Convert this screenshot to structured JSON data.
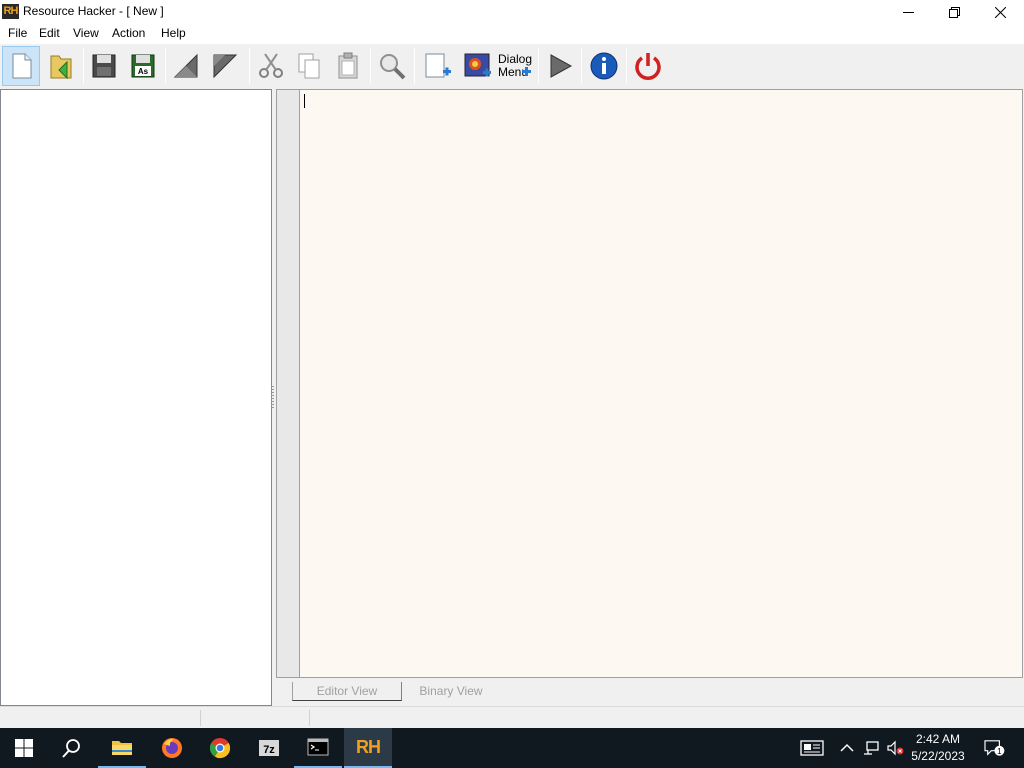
{
  "window": {
    "title": "Resource Hacker - [ New ]",
    "app_icon_text": "RH"
  },
  "menu": [
    {
      "label": "File"
    },
    {
      "label": "Edit"
    },
    {
      "label": "View"
    },
    {
      "label": "Action"
    },
    {
      "label": "Help"
    }
  ],
  "toolbar": {
    "dialog_menu_label_1": "Dialog",
    "dialog_menu_label_2": "Menu"
  },
  "tabs": {
    "editor_view": "Editor View",
    "binary_view": "Binary View"
  },
  "taskbar": {
    "clock_time": "2:42 AM",
    "clock_date": "5/22/2023",
    "notification_count": "1",
    "active_app_label": "RH"
  },
  "colors": {
    "editor_bg": "#fdf8f2",
    "taskbar_bg": "#101820",
    "accent": "#7ab8f0"
  }
}
